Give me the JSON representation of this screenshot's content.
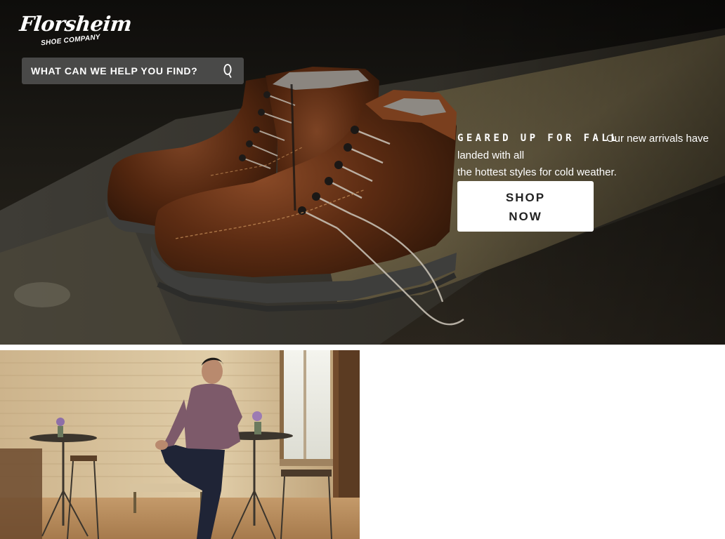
{
  "brand": {
    "logo_script": "Florsheim",
    "logo_sub": "SHOE COMPANY"
  },
  "search": {
    "placeholder": "WHAT CAN WE HELP YOU FIND?",
    "icon": "search-icon"
  },
  "hero": {
    "heading": "GEARED UP FOR FALL",
    "body_line_1": "Our new arrivals have",
    "body_line_2": "landed with all",
    "body_line_3": "the hottest styles for cold weather.",
    "cta_line_1": "SHOP",
    "cta_line_2": "NOW"
  },
  "colors": {
    "hero_background": "#15130f",
    "button_background": "#ffffff",
    "button_text": "#222222",
    "search_background": "#555555"
  }
}
